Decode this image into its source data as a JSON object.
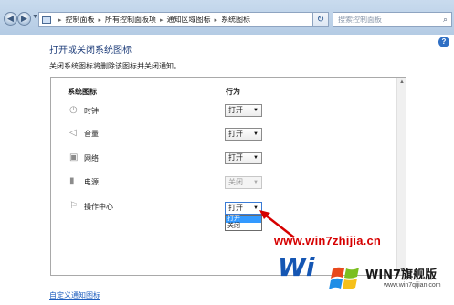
{
  "address_bar": {
    "breadcrumbs": [
      "控制面板",
      "所有控制面板项",
      "通知区域图标",
      "系统图标"
    ],
    "search_placeholder": "搜索控制面板"
  },
  "page": {
    "title": "打开或关闭系统图标",
    "description": "关闭系统图标将删除该图标并关闭通知。"
  },
  "table": {
    "headers": {
      "icon": "系统图标",
      "behavior": "行为"
    },
    "rows": [
      {
        "icon": "clock-icon",
        "label": "时钟",
        "value": "打开",
        "enabled": true
      },
      {
        "icon": "volume-icon",
        "label": "音量",
        "value": "打开",
        "enabled": true
      },
      {
        "icon": "network-icon",
        "label": "网络",
        "value": "打开",
        "enabled": true
      },
      {
        "icon": "power-icon",
        "label": "电源",
        "value": "关闭",
        "enabled": false
      },
      {
        "icon": "action-center-flag-icon",
        "label": "操作中心",
        "value": "打开",
        "enabled": true
      }
    ],
    "open_dropdown": {
      "options": [
        "打开",
        "关闭"
      ],
      "highlighted": "打开"
    }
  },
  "footer": {
    "customize_link": "自定义通知图标"
  },
  "watermark": {
    "url": "www.win7zhijia.cn",
    "big_text": "Wi",
    "brand": "WIN7旗舰版",
    "site": "www.win7qijian.com"
  },
  "colors": {
    "link": "#1f5fbf",
    "title": "#1e3d7a",
    "annotation_red": "#d60000",
    "dropdown_highlight": "#3399ff"
  }
}
